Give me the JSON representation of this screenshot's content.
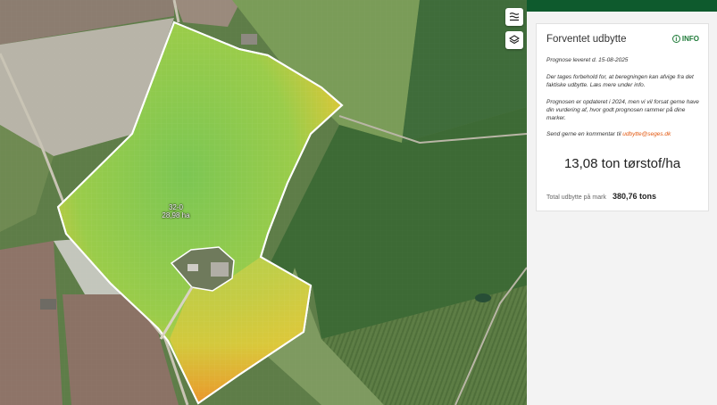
{
  "map": {
    "field_id": "32-0",
    "field_area": "28,98 ha",
    "controls": [
      {
        "name": "filter-icon"
      },
      {
        "name": "layers-icon"
      }
    ]
  },
  "panel": {
    "title": "Forventet udbytte",
    "info_label": "INFO",
    "forecast_delivered": "Prognose leveret d. 15-08-2025",
    "disclaimer": "Der tages forbehold for, at beregningen kan afvige fra det faktiske udbytte. Læs mere under info.",
    "update_note": "Prognosen er opdateret i 2024, men vi vil forsat gerne have din vurdering af, hvor godt prognosen rammer på dine marker.",
    "comment_prefix": "Send gerne en kommentar til",
    "comment_email": "udbytte@seges.dk",
    "yield_value": "13,08 ton tørstof/ha",
    "total_label": "Total udbytte på mark",
    "total_value": "380,76 tons"
  },
  "colors": {
    "topbar": "#0e5a2d",
    "accent_green": "#1e7a38",
    "link_orange": "#e2570f"
  }
}
